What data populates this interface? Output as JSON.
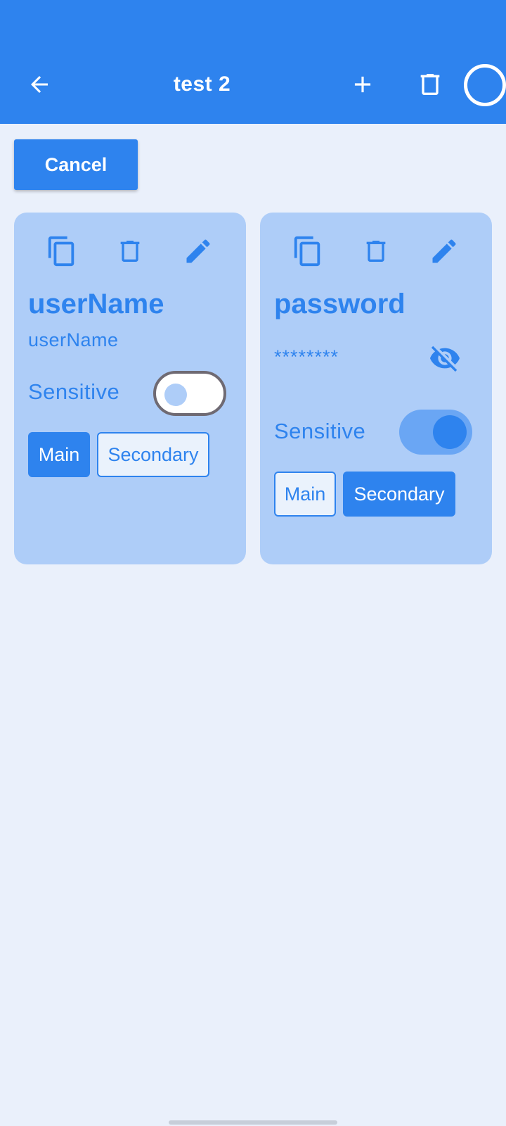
{
  "appbar": {
    "title": "test 2",
    "back_icon": "arrow-left-icon",
    "add_icon": "plus-icon",
    "delete_icon": "trash-icon",
    "status_icon": "circle-icon",
    "background": "#2e83ee"
  },
  "actions": {
    "cancel_label": "Cancel"
  },
  "cards": [
    {
      "title": "userName",
      "value": "userName",
      "sensitive_label": "Sensitive",
      "sensitive": false,
      "chips": [
        "Main",
        "Secondary"
      ],
      "selected_chip": "Main",
      "icons": [
        "copy-icon",
        "trash-icon",
        "edit-icon"
      ]
    },
    {
      "title": "password",
      "value": "********",
      "sensitive_label": "Sensitive",
      "sensitive": true,
      "chips": [
        "Main",
        "Secondary"
      ],
      "selected_chip": "Secondary",
      "icons": [
        "copy-icon",
        "trash-icon",
        "edit-icon",
        "eye-off-icon"
      ]
    }
  ],
  "colors": {
    "accent": "#2e83ee",
    "card": "#aecdf8",
    "page": "#eaf0fb"
  }
}
